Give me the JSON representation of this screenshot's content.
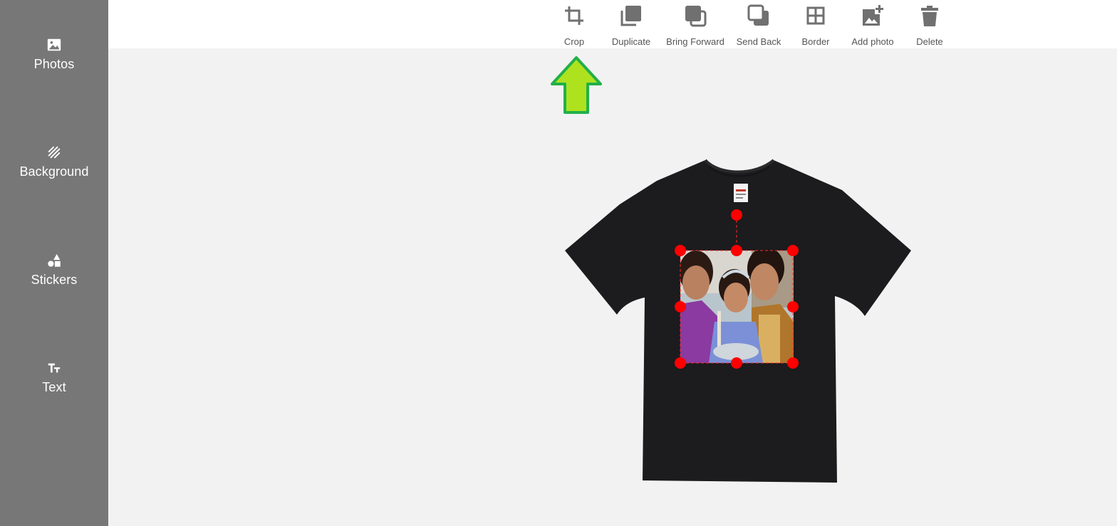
{
  "sidebar": {
    "items": [
      {
        "label": "Photos",
        "icon": "image-icon"
      },
      {
        "label": "Background",
        "icon": "pattern-icon"
      },
      {
        "label": "Stickers",
        "icon": "shapes-icon"
      },
      {
        "label": "Text",
        "icon": "text-size-icon"
      }
    ]
  },
  "toolbar": {
    "items": [
      {
        "label": "Crop",
        "icon": "crop-icon"
      },
      {
        "label": "Duplicate",
        "icon": "duplicate-icon"
      },
      {
        "label": "Bring Forward",
        "icon": "bring-forward-icon"
      },
      {
        "label": "Send Back",
        "icon": "send-back-icon"
      },
      {
        "label": "Border",
        "icon": "border-grid-icon"
      },
      {
        "label": "Add photo",
        "icon": "add-photo-icon"
      },
      {
        "label": "Delete",
        "icon": "trash-icon"
      }
    ]
  },
  "canvas": {
    "product": "t-shirt",
    "shirt_color": "#1c1b1d",
    "selection_color": "#ff0000"
  },
  "colors": {
    "sidebar_bg": "#777777",
    "toolbar_bg": "#ffffff",
    "workspace_bg": "#f2f2f2",
    "toolbar_icon": "#707070",
    "arrow_fill": "#aee21e",
    "arrow_stroke": "#22b04a"
  }
}
